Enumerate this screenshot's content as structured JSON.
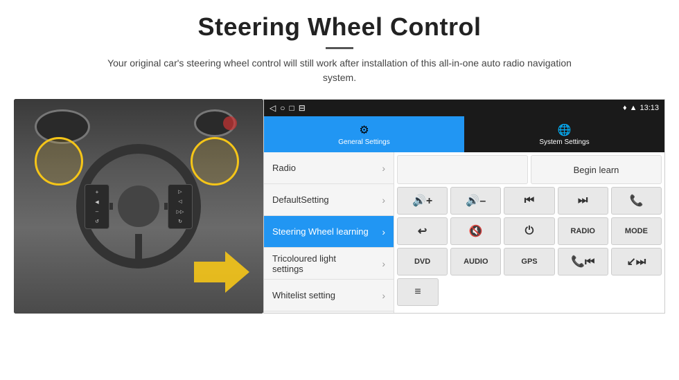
{
  "header": {
    "title": "Steering Wheel Control",
    "subtitle": "Your original car's steering wheel control will still work after installation of this all-in-one auto radio navigation system."
  },
  "android": {
    "status_bar": {
      "time": "13:13",
      "icons": [
        "◁",
        "○",
        "□",
        "⊟"
      ]
    },
    "tabs": [
      {
        "label": "General Settings",
        "icon": "⚙",
        "active": true
      },
      {
        "label": "System Settings",
        "icon": "🌐",
        "active": false
      }
    ],
    "menu_items": [
      {
        "label": "Radio",
        "active": false
      },
      {
        "label": "DefaultSetting",
        "active": false
      },
      {
        "label": "Steering Wheel learning",
        "active": true
      },
      {
        "label": "Tricoloured light settings",
        "active": false
      },
      {
        "label": "Whitelist setting",
        "active": false
      }
    ],
    "control_buttons": {
      "begin_learn": "Begin learn",
      "row1": [
        "🔊+",
        "🔊–",
        "⏮",
        "⏭",
        "📞"
      ],
      "row2": [
        "↩",
        "🔊x",
        "⏻",
        "RADIO",
        "MODE"
      ],
      "row3": [
        "DVD",
        "AUDIO",
        "GPS",
        "📞⏮",
        "↙⏭"
      ],
      "row4": [
        "≡"
      ]
    }
  }
}
